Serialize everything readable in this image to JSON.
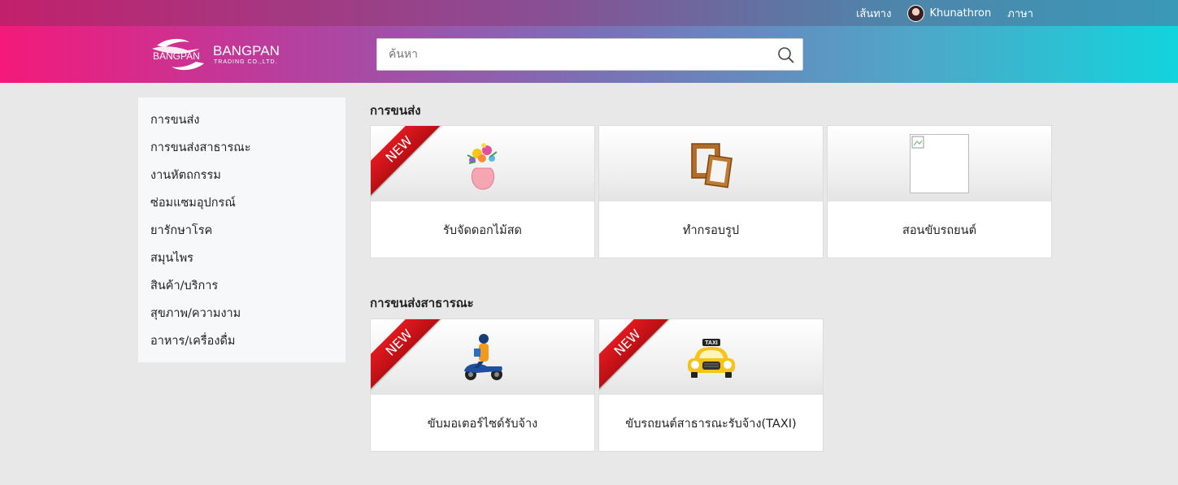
{
  "topbar": {
    "route_label": "เส้นทาง",
    "user_name": "Khunathron",
    "language_label": "ภาษา"
  },
  "header": {
    "logo_text": "BANGPAN",
    "logo_name": "BANGPAN",
    "logo_subtitle": "TRADING CO.,LTD.",
    "search_placeholder": "ค้นหา"
  },
  "sidebar": {
    "items": [
      {
        "label": "การขนส่ง"
      },
      {
        "label": "การขนส่งสาธารณะ"
      },
      {
        "label": "งานหัตถกรรม"
      },
      {
        "label": "ซ่อมแซมอุปกรณ์"
      },
      {
        "label": "ยารักษาโรค"
      },
      {
        "label": "สมุนไพร"
      },
      {
        "label": "สินค้า/บริการ"
      },
      {
        "label": "สุขภาพ/ความงาม"
      },
      {
        "label": "อาหาร/เครื่องดื่ม"
      }
    ]
  },
  "sections": [
    {
      "title": "การขนส่ง",
      "cards": [
        {
          "label": "รับจัดดอกไม้สด",
          "badge": "NEW",
          "icon": "flower-vase-icon"
        },
        {
          "label": "ทำกรอบรูป",
          "icon": "picture-frame-icon"
        },
        {
          "label": "สอนขับรถยนต์",
          "icon": "broken-image-icon"
        }
      ]
    },
    {
      "title": "การขนส่งสาธารณะ",
      "cards": [
        {
          "label": "ขับมอเตอร์ไซด์รับจ้าง",
          "badge": "NEW",
          "icon": "motorbike-taxi-icon"
        },
        {
          "label": "ขับรถยนต์สาธารณะรับจ้าง(TAXI)",
          "badge": "NEW",
          "icon": "taxi-icon",
          "icon_text": "TAXI"
        }
      ]
    }
  ],
  "colors": {
    "header_gradient_start": "#f4197a",
    "header_gradient_end": "#12d4dc",
    "ribbon": "#d8151b",
    "page_bg": "#e8e8e8"
  }
}
